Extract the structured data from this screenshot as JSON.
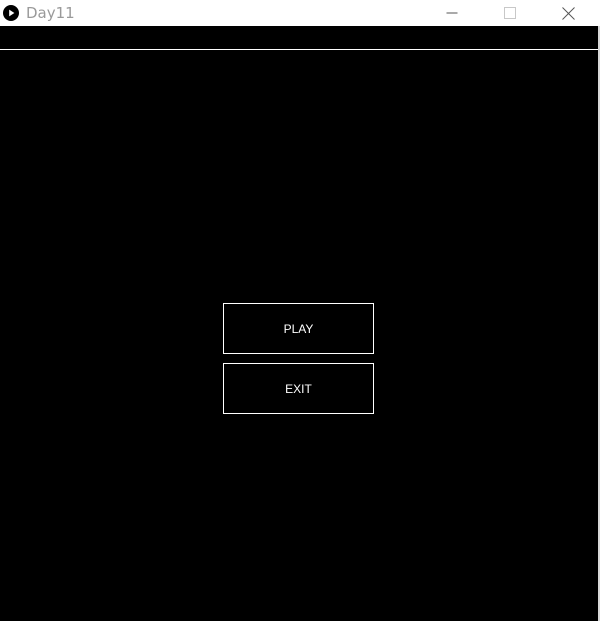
{
  "window": {
    "title": "Day11",
    "icon": "play-circle-icon",
    "controls": {
      "minimize_icon": "minimize-icon",
      "maximize_icon": "maximize-icon",
      "close_icon": "close-icon"
    }
  },
  "menu": {
    "play_label": "PLAY",
    "exit_label": "EXIT"
  },
  "colors": {
    "background": "#000000",
    "foreground": "#ffffff",
    "titlebar": "#ffffff",
    "title_text": "#9a9a9a"
  }
}
